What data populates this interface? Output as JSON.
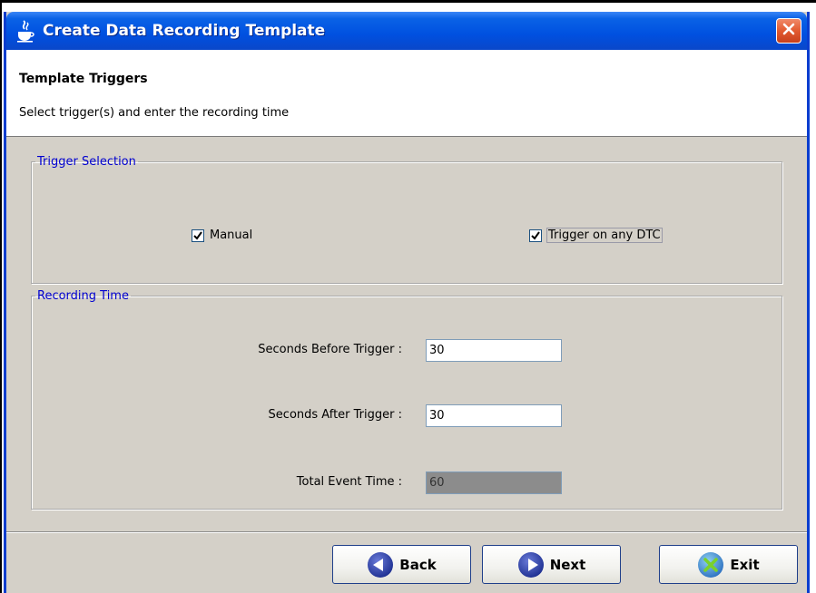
{
  "window": {
    "title": "Create Data Recording Template",
    "icon": "java-icon",
    "close_icon": "close-icon",
    "title_color": "#0a55e0"
  },
  "header": {
    "title": "Template Triggers",
    "subtitle": "Select trigger(s) and enter the recording time"
  },
  "trigger_selection": {
    "legend": "Trigger Selection",
    "manual": {
      "label": "Manual",
      "checked": true
    },
    "any_dtc": {
      "label": "Trigger on any DTC",
      "checked": true
    }
  },
  "recording_time": {
    "legend": "Recording Time",
    "before": {
      "label": "Seconds Before Trigger :",
      "value": "30"
    },
    "after": {
      "label": "Seconds After Trigger :",
      "value": "30"
    },
    "total": {
      "label": "Total Event Time :",
      "value": "60",
      "enabled": false
    }
  },
  "buttons": {
    "back": {
      "label": "Back",
      "icon": "arrow-left-icon"
    },
    "next": {
      "label": "Next",
      "icon": "arrow-right-icon"
    },
    "exit": {
      "label": "Exit",
      "icon": "x-icon"
    }
  },
  "colors": {
    "legend": "#0000d0",
    "dialog_bg": "#d4d0c8",
    "accent": "#0a3dcf"
  }
}
